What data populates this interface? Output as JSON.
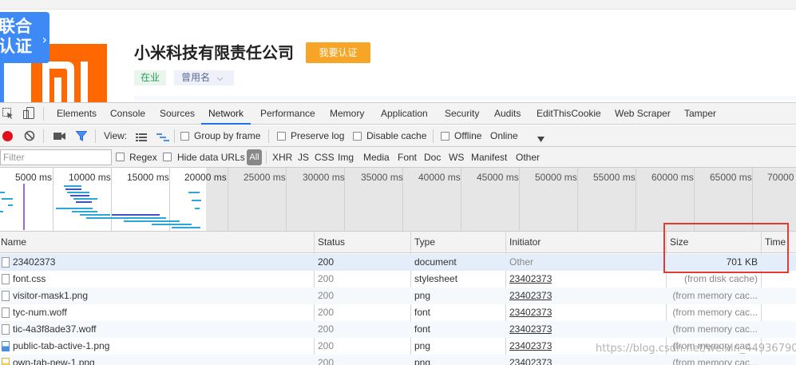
{
  "page": {
    "badge_line1": "联合",
    "badge_line2": "认证",
    "company_name": "小米科技有限责任公司",
    "cert_button": "我要认证",
    "status_tag": "在业",
    "former_name_tag": "曾用名"
  },
  "devtools": {
    "tabs": [
      "Elements",
      "Console",
      "Sources",
      "Network",
      "Performance",
      "Memory",
      "Application",
      "Security",
      "Audits",
      "EditThisCookie",
      "Web Scraper",
      "Tamper"
    ],
    "active_tab": "Network",
    "toolbar": {
      "view_label": "View:",
      "group_by_frame": "Group by frame",
      "preserve_log": "Preserve log",
      "disable_cache": "Disable cache",
      "offline": "Offline",
      "throttle": "Online"
    },
    "filter": {
      "placeholder": "Filter",
      "regex": "Regex",
      "hide_data_urls": "Hide data URLs",
      "all": "All",
      "types": [
        "XHR",
        "JS",
        "CSS",
        "Img",
        "Media",
        "Font",
        "Doc",
        "WS",
        "Manifest",
        "Other"
      ]
    },
    "timeline_ticks": [
      "5000 ms",
      "10000 ms",
      "15000 ms",
      "20000 ms",
      "25000 ms",
      "30000 ms",
      "35000 ms",
      "40000 ms",
      "45000 ms",
      "50000 ms",
      "55000 ms",
      "60000 ms",
      "65000 ms",
      "70000"
    ],
    "columns": [
      "Name",
      "Status",
      "Type",
      "Initiator",
      "Size",
      "Time"
    ],
    "rows": [
      {
        "name": "23402373",
        "status": "200",
        "type": "document",
        "initiator": "Other",
        "size": "701 KB",
        "icon": "document"
      },
      {
        "name": "font.css",
        "status": "200",
        "type": "stylesheet",
        "initiator": "23402373",
        "size": "(from disk cache)",
        "icon": "document"
      },
      {
        "name": "visitor-mask1.png",
        "status": "200",
        "type": "png",
        "initiator": "23402373",
        "size": "(from memory cac...",
        "icon": "document"
      },
      {
        "name": "tyc-num.woff",
        "status": "200",
        "type": "font",
        "initiator": "23402373",
        "size": "(from memory cac...",
        "icon": "document"
      },
      {
        "name": "tic-4a3f8ade37.woff",
        "status": "200",
        "type": "font",
        "initiator": "23402373",
        "size": "(from memory cac...",
        "icon": "document"
      },
      {
        "name": "public-tab-active-1.png",
        "status": "200",
        "type": "png",
        "initiator": "23402373",
        "size": "(from memory cac...",
        "icon": "image"
      },
      {
        "name": "own-tab-new-1.png",
        "status": "200",
        "type": "png",
        "initiator": "23402373",
        "size": "(from memory cac...",
        "icon": "image-yellow"
      }
    ]
  },
  "watermark": "https://blog.csdn.net/weixin_44936790"
}
